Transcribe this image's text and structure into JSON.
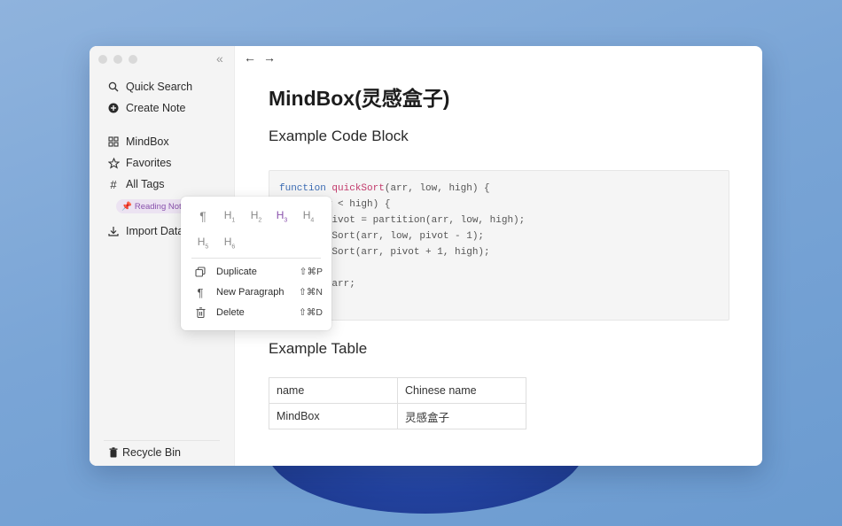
{
  "sidebar": {
    "items": [
      {
        "label": "Quick Search",
        "icon": "search-icon"
      },
      {
        "label": "Create Note",
        "icon": "plus-circle-icon"
      },
      {
        "label": "MindBox",
        "icon": "grid-icon"
      },
      {
        "label": "Favorites",
        "icon": "star-icon"
      },
      {
        "label": "All Tags",
        "icon": "hash-icon"
      },
      {
        "label": "Import Data",
        "icon": "download-icon"
      }
    ],
    "tag": "Reading Note",
    "recycle": "Recycle Bin"
  },
  "doc": {
    "title": "MindBox(灵感盒子)",
    "code_heading": "Example Code Block",
    "table_heading": "Example Table",
    "code_lines": [
      {
        "kw": "function ",
        "fn": "quickSort",
        "rest": "(arr, low, high) {"
      },
      {
        "rest": "  if (low < high) {"
      },
      {
        "rest": "    let pivot = partition(arr, low, high);"
      },
      {
        "rest": "    quickSort(arr, low, pivot - 1);"
      },
      {
        "rest": "    quickSort(arr, pivot + 1, high);"
      },
      {
        "rest": "  }"
      },
      {
        "rest": "  return arr;"
      },
      {
        "rest": "}"
      }
    ],
    "table": {
      "header": [
        "name",
        "Chinese name"
      ],
      "rows": [
        [
          "MindBox",
          "灵感盒子"
        ]
      ]
    }
  },
  "menu": {
    "headings": [
      "¶",
      "H1",
      "H2",
      "H3",
      "H4",
      "H5",
      "H6"
    ],
    "active_heading": "H3",
    "items": [
      {
        "label": "Duplicate",
        "shortcut": "⇧⌘P",
        "icon": "duplicate-icon"
      },
      {
        "label": "New Paragraph",
        "shortcut": "⇧⌘N",
        "icon": "paragraph-icon"
      },
      {
        "label": "Delete",
        "shortcut": "⇧⌘D",
        "icon": "trash-icon"
      }
    ]
  },
  "colors": {
    "accent": "#8a52ad",
    "code_keyword": "#3b6bb3",
    "code_function": "#c23a6b"
  }
}
